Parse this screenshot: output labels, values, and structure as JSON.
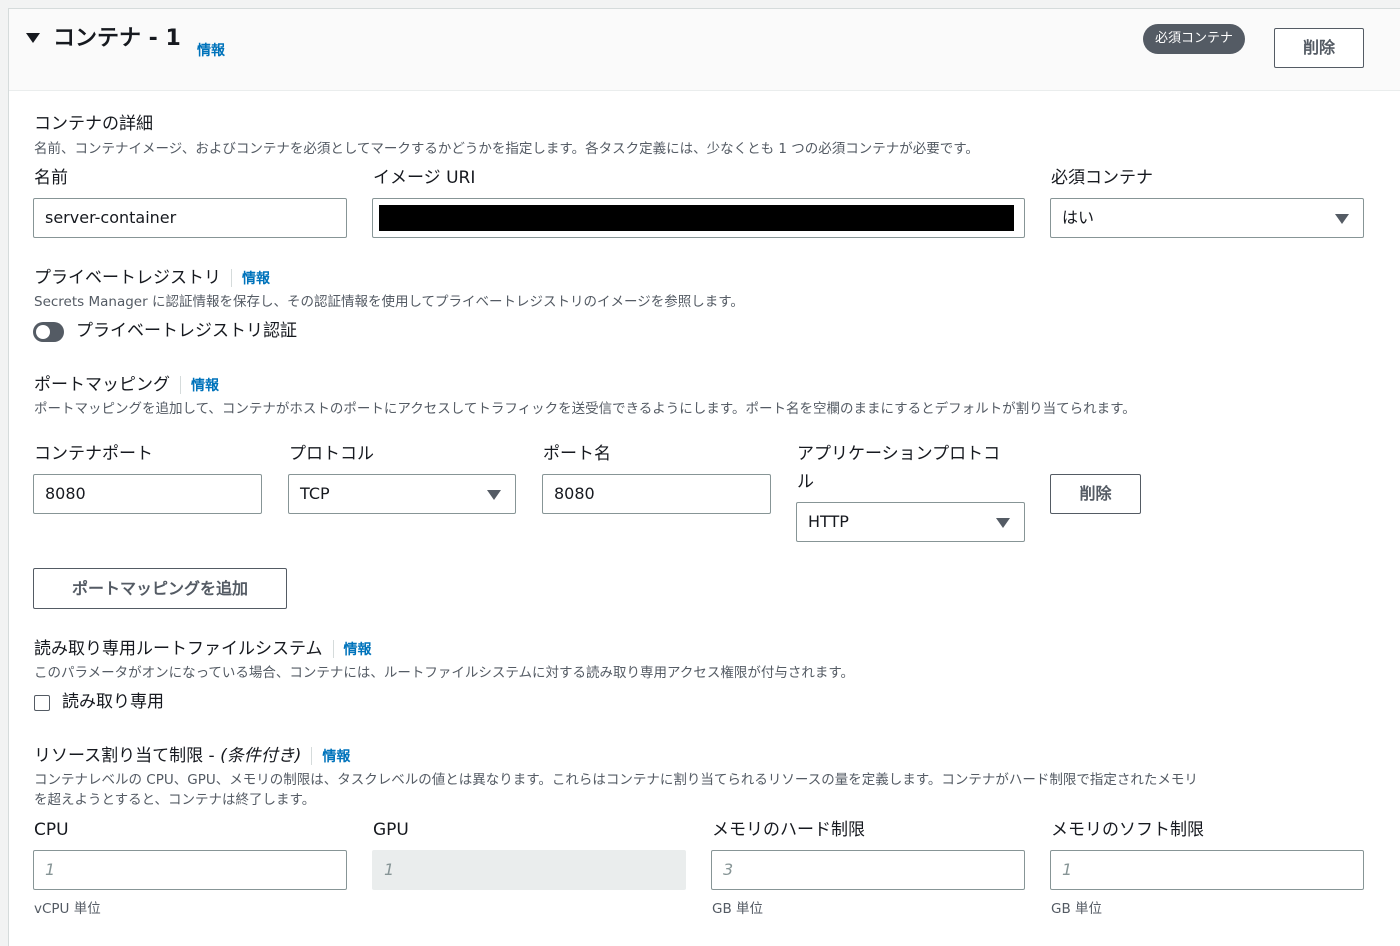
{
  "header": {
    "title": "コンテナ - 1",
    "info": "情報",
    "badge": "必須コンテナ",
    "delete_label": "削除"
  },
  "details": {
    "title": "コンテナの詳細",
    "description": "名前、コンテナイメージ、およびコンテナを必須としてマークするかどうかを指定します。各タスク定義には、少なくとも 1 つの必須コンテナが必要です。",
    "name_label": "名前",
    "name_value": "server-container",
    "image_label": "イメージ URI",
    "image_value": "",
    "essential_label": "必須コンテナ",
    "essential_value": "はい"
  },
  "private_registry": {
    "title": "プライベートレジストリ",
    "info": "情報",
    "description": "Secrets Manager に認証情報を保存し、その認証情報を使用してプライベートレジストリのイメージを参照します。",
    "toggle_label": "プライベートレジストリ認証",
    "toggle_on": false
  },
  "port_mappings": {
    "title": "ポートマッピング",
    "info": "情報",
    "description": "ポートマッピングを追加して、コンテナがホストのポートにアクセスしてトラフィックを送受信できるようにします。ポート名を空欄のままにするとデフォルトが割り当てられます。",
    "container_port_label": "コンテナポート",
    "protocol_label": "プロトコル",
    "port_name_label": "ポート名",
    "app_protocol_label_line1": "アプリケーションプロトコ",
    "app_protocol_label_line2": "ル",
    "container_port_value": "8080",
    "protocol_value": "TCP",
    "port_name_value": "8080",
    "app_protocol_value": "HTTP",
    "remove_label": "削除",
    "add_label": "ポートマッピングを追加"
  },
  "readonly_fs": {
    "title": "読み取り専用ルートファイルシステム",
    "info": "情報",
    "description": "このパラメータがオンになっている場合、コンテナには、ルートファイルシステムに対する読み取り専用アクセス権限が付与されます。",
    "checkbox_label": "読み取り専用",
    "checked": false
  },
  "resources": {
    "title_main": "リソース割り当て制限 - ",
    "title_italic": "(条件付き)",
    "info": "情報",
    "description_line1": "コンテナレベルの CPU、GPU、メモリの制限は、タスクレベルの値とは異なります。これらはコンテナに割り当てられるリソースの量を定義します。コンテナがハード制限で指定されたメモリ",
    "description_line2": "を超えようとすると、コンテナは終了します。",
    "cpu_label": "CPU",
    "cpu_placeholder": "1",
    "cpu_hint": "vCPU 単位",
    "gpu_label": "GPU",
    "gpu_placeholder": "1",
    "mem_hard_label": "メモリのハード制限",
    "mem_hard_placeholder": "3",
    "mem_hard_hint": "GB 単位",
    "mem_soft_label": "メモリのソフト制限",
    "mem_soft_placeholder": "1",
    "mem_soft_hint": "GB 単位"
  }
}
